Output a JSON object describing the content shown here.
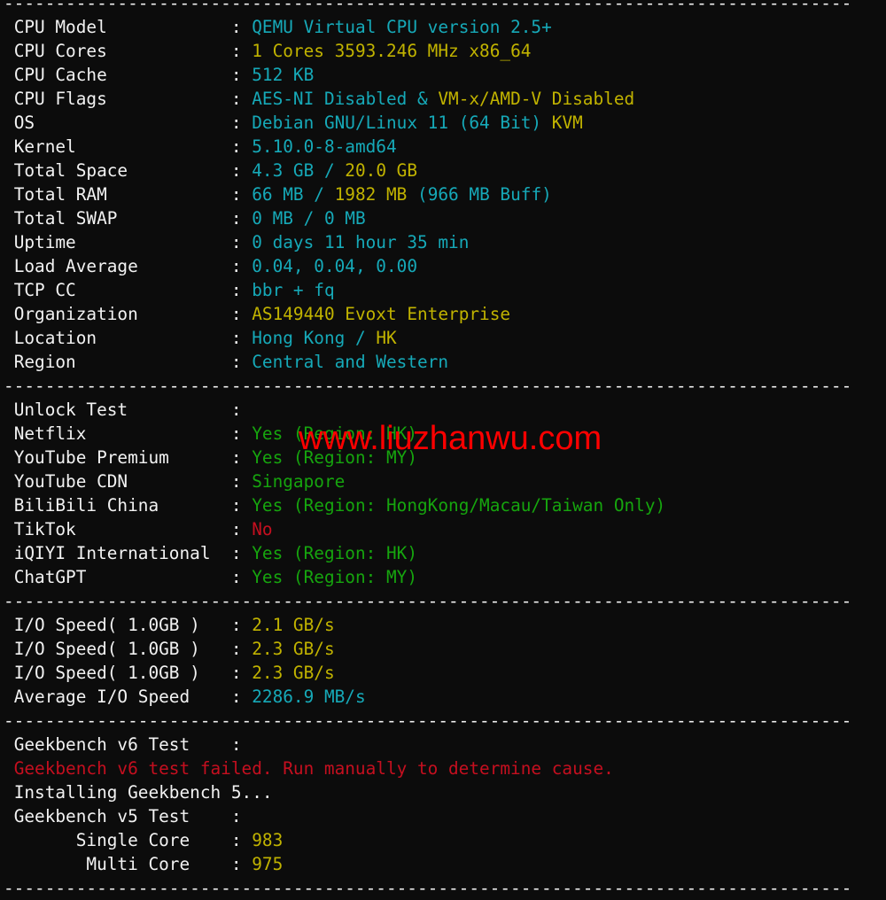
{
  "colors": {
    "label": "#f2f2f2",
    "cyan": "#16a9b8",
    "yellow": "#c1b300",
    "green": "#16a50e",
    "red": "#c50f1f",
    "watermark": "#ff0000"
  },
  "separator": "----------------------------------------------------------------------------------",
  "watermark": "www.liuzhanwu.com",
  "sections": [
    {
      "rows": [
        {
          "label": "CPU Model",
          "value": [
            {
              "text": "QEMU Virtual CPU version 2.5+",
              "color": "cyan"
            }
          ]
        },
        {
          "label": "CPU Cores",
          "value": [
            {
              "text": "1 Cores 3593.246 MHz x86_64",
              "color": "yellow"
            }
          ]
        },
        {
          "label": "CPU Cache",
          "value": [
            {
              "text": "512 KB",
              "color": "cyan"
            }
          ]
        },
        {
          "label": "CPU Flags",
          "value": [
            {
              "text": "AES-NI Disabled & ",
              "color": "cyan"
            },
            {
              "text": "VM-x/AMD-V Disabled",
              "color": "yellow"
            }
          ]
        },
        {
          "label": "OS",
          "value": [
            {
              "text": "Debian GNU/Linux 11 (64 Bit) ",
              "color": "cyan"
            },
            {
              "text": "KVM",
              "color": "yellow"
            }
          ]
        },
        {
          "label": "Kernel",
          "value": [
            {
              "text": "5.10.0-8-amd64",
              "color": "cyan"
            }
          ]
        },
        {
          "label": "Total Space",
          "value": [
            {
              "text": "4.3 GB / ",
              "color": "cyan"
            },
            {
              "text": "20.0 GB",
              "color": "yellow"
            }
          ]
        },
        {
          "label": "Total RAM",
          "value": [
            {
              "text": "66 MB / ",
              "color": "cyan"
            },
            {
              "text": "1982 MB",
              "color": "yellow"
            },
            {
              "text": " (966 MB Buff)",
              "color": "cyan"
            }
          ]
        },
        {
          "label": "Total SWAP",
          "value": [
            {
              "text": "0 MB / 0 MB",
              "color": "cyan"
            }
          ]
        },
        {
          "label": "Uptime",
          "value": [
            {
              "text": "0 days 11 hour 35 min",
              "color": "cyan"
            }
          ]
        },
        {
          "label": "Load Average",
          "value": [
            {
              "text": "0.04, 0.04, 0.00",
              "color": "cyan"
            }
          ]
        },
        {
          "label": "TCP CC",
          "value": [
            {
              "text": "bbr + fq",
              "color": "cyan"
            }
          ]
        },
        {
          "label": "Organization",
          "value": [
            {
              "text": "AS149440 Evoxt Enterprise",
              "color": "yellow"
            }
          ]
        },
        {
          "label": "Location",
          "value": [
            {
              "text": "Hong Kong / ",
              "color": "cyan"
            },
            {
              "text": "HK",
              "color": "yellow"
            }
          ]
        },
        {
          "label": "Region",
          "value": [
            {
              "text": "Central and Western",
              "color": "cyan"
            }
          ]
        }
      ]
    },
    {
      "rows": [
        {
          "label": "Unlock Test",
          "value": []
        },
        {
          "label": "Netflix",
          "value": [
            {
              "text": "Yes (Region: HK)",
              "color": "green"
            }
          ]
        },
        {
          "label": "YouTube Premium",
          "value": [
            {
              "text": "Yes (Region: MY)",
              "color": "green"
            }
          ]
        },
        {
          "label": "YouTube CDN",
          "value": [
            {
              "text": "Singapore",
              "color": "green"
            }
          ]
        },
        {
          "label": "BiliBili China",
          "value": [
            {
              "text": "Yes (Region: HongKong/Macau/Taiwan Only)",
              "color": "green"
            }
          ]
        },
        {
          "label": "TikTok",
          "value": [
            {
              "text": "No",
              "color": "red"
            }
          ]
        },
        {
          "label": "iQIYI International",
          "value": [
            {
              "text": "Yes (Region: HK)",
              "color": "green"
            }
          ]
        },
        {
          "label": "ChatGPT",
          "value": [
            {
              "text": "Yes (Region: MY)",
              "color": "green"
            }
          ]
        }
      ]
    },
    {
      "rows": [
        {
          "label": "I/O Speed( 1.0GB )",
          "value": [
            {
              "text": "2.1 GB/s",
              "color": "yellow"
            }
          ]
        },
        {
          "label": "I/O Speed( 1.0GB )",
          "value": [
            {
              "text": "2.3 GB/s",
              "color": "yellow"
            }
          ]
        },
        {
          "label": "I/O Speed( 1.0GB )",
          "value": [
            {
              "text": "2.3 GB/s",
              "color": "yellow"
            }
          ]
        },
        {
          "label": "Average I/O Speed",
          "value": [
            {
              "text": "2286.9 MB/s",
              "color": "cyan"
            }
          ]
        }
      ]
    },
    {
      "rows": [
        {
          "label": "Geekbench v6 Test",
          "value": []
        },
        {
          "plain": "Geekbench v6 test failed. Run manually to determine cause.",
          "color": "red"
        },
        {
          "plain": "Installing Geekbench 5...",
          "color": "white"
        },
        {
          "label": "Geekbench v5 Test",
          "value": []
        },
        {
          "label": "      Single Core",
          "value": [
            {
              "text": "983",
              "color": "yellow"
            }
          ]
        },
        {
          "label": "       Multi Core",
          "value": [
            {
              "text": "975",
              "color": "yellow"
            }
          ]
        }
      ]
    }
  ]
}
